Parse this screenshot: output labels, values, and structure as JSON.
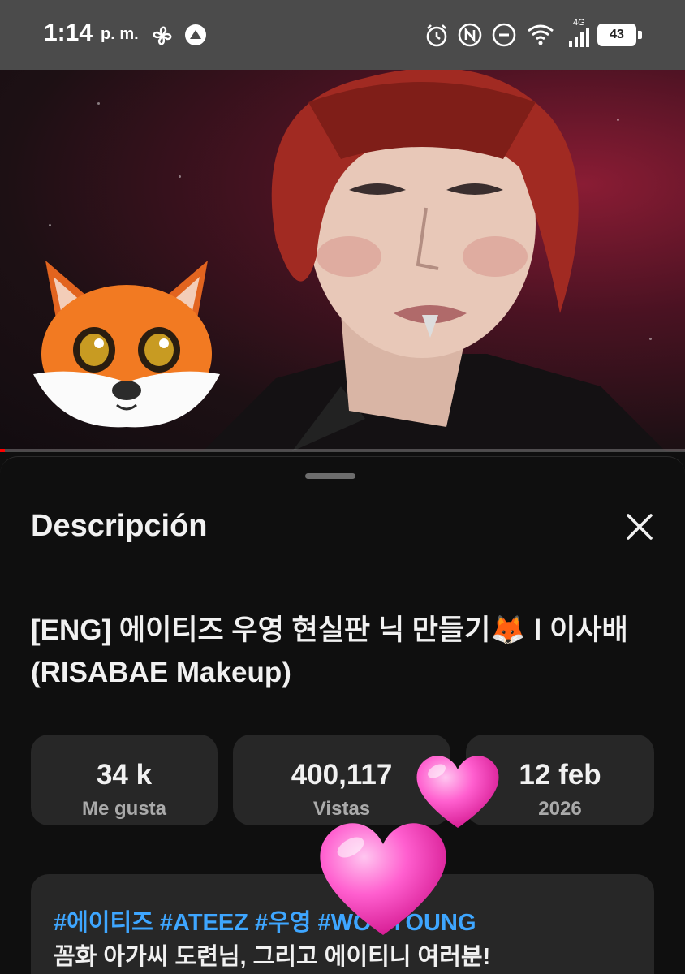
{
  "status_bar": {
    "time": "1:14",
    "ampm": "p. m.",
    "network_label": "4G",
    "battery": "43",
    "icons": [
      "pinwheel-icon",
      "app-notification-icon",
      "alarm-icon",
      "nfc-icon",
      "do-not-disturb-icon",
      "wifi-icon",
      "signal-icon",
      "battery-icon"
    ]
  },
  "video": {
    "overlay_stickers": [
      "fox-emoji-icon"
    ]
  },
  "sheet": {
    "title": "Descripción",
    "video_title": "[ENG] 에이티즈 우영 현실판 닉 만들기🦊 l 이사배(RISABAE Makeup)",
    "stats": [
      {
        "value": "34 k",
        "label": "Me gusta"
      },
      {
        "value": "400,117",
        "label": "Vistas"
      },
      {
        "value": "12 feb",
        "label": "2026"
      }
    ],
    "description": {
      "hashtags": "#에이티즈 #ATEEZ #우영 #WOOYOUNG",
      "first_line": "꼼화 아가씨 도련님, 그리고 에이티니 여러분!"
    }
  },
  "colors": {
    "background": "#0f0f0f",
    "card": "#272727",
    "hashtag": "#3ea6ff",
    "status_bar": "#4b4b4b",
    "heart": "#ff4fc3"
  },
  "overlay_stickers": [
    "heart-icon",
    "heart-icon"
  ]
}
